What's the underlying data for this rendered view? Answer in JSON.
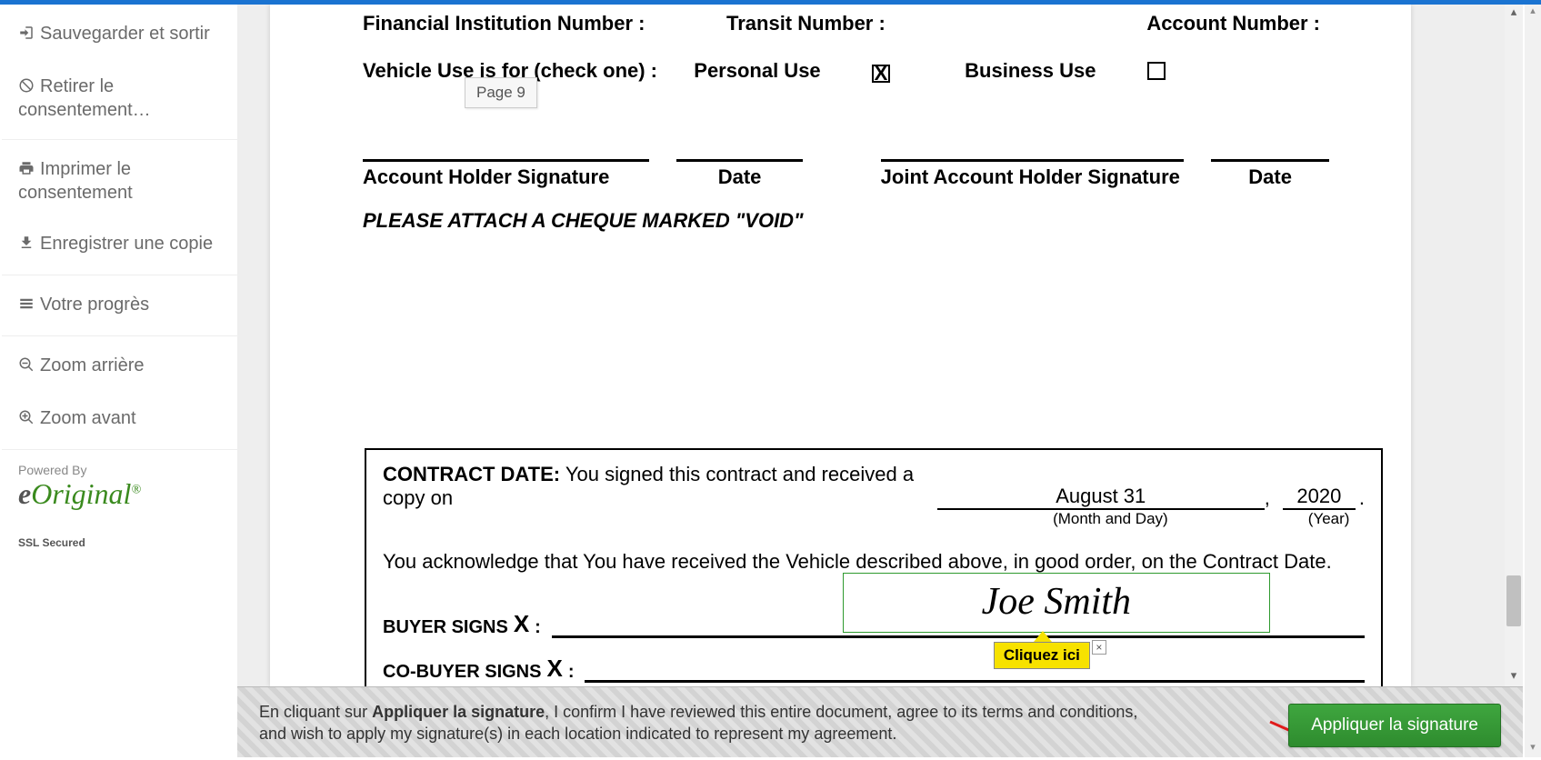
{
  "sidebar": {
    "save_exit": "Sauvegarder et sortir",
    "withdraw": "Retirer le consentement…",
    "print": "Imprimer le consentement",
    "save_copy": "Enregistrer une copie",
    "progress": "Votre progrès",
    "zoom_out": "Zoom arrière",
    "zoom_in": "Zoom avant",
    "powered_by": "Powered By",
    "logo_e": "e",
    "logo_rest": "Original",
    "ssl": "SSL Secured"
  },
  "page_tag": "Page 9",
  "doc": {
    "fin_inst": "Financial Institution Number :",
    "transit": "Transit Number :",
    "account": "Account Number :",
    "vehicle_use_label": "Vehicle Use is for (check one) :",
    "personal": "Personal Use",
    "business": "Business Use",
    "personal_checked": "X",
    "acct_holder_sig": "Account Holder Signature",
    "date": "Date",
    "joint_sig": "Joint Account Holder Signature",
    "void": "PLEASE ATTACH A CHEQUE MARKED \"VOID\"",
    "contract_date_label": "CONTRACT DATE:",
    "contract_date_text": "You signed this contract and received a copy on",
    "month_day": "August 31",
    "year": "2020",
    "month_day_sub": "(Month and Day)",
    "year_sub": "(Year)",
    "ack": "You acknowledge that You have received the Vehicle described above, in good order, on the Contract Date.",
    "buyer_signs": "BUYER SIGNS",
    "cobuyer_signs": "CO-BUYER SIGNS",
    "x": "X",
    "colon": ":",
    "signature_name": "Joe Smith",
    "tooltip": "Cliquez ici",
    "tooltip_close": "×"
  },
  "footer": {
    "msg_prefix": "En cliquant sur ",
    "msg_bold": "Appliquer la signature",
    "msg_suffix": ", I confirm I have reviewed this entire document, agree to its terms and conditions, and wish to apply my signature(s) in each location indicated to represent my agreement.",
    "button": "Appliquer la signature"
  }
}
